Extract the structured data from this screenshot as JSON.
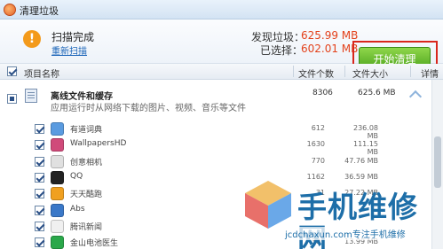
{
  "window": {
    "title": "清理垃圾"
  },
  "summary": {
    "status": "扫描完成",
    "rescan": "重新扫描",
    "found_label": "发现垃圾：",
    "found_value": "625.99 MB",
    "selected_label": "已选择：",
    "selected_value": "602.01 MB",
    "start_button": "开始清理"
  },
  "columns": {
    "name": "项目名称",
    "count": "文件个数",
    "size": "文件大小",
    "detail": "详情"
  },
  "group": {
    "title": "离线文件和缓存",
    "description": "应用运行时从网络下载的图片、视频、音乐等文件",
    "count": "8306",
    "size": "625.6 MB"
  },
  "rows": [
    {
      "name": "有道词典",
      "count": "612",
      "size": "236.08 MB",
      "icon": "book-icon",
      "color": "#5a9be0"
    },
    {
      "name": "WallpapersHD",
      "count": "1630",
      "size": "111.15 MB",
      "icon": "wallpaper-icon",
      "color": "#d04a7a"
    },
    {
      "name": "创意相机",
      "count": "770",
      "size": "47.76 MB",
      "icon": "camera-icon",
      "color": "#e0e0e0"
    },
    {
      "name": "QQ",
      "count": "1162",
      "size": "36.59 MB",
      "icon": "penguin-icon",
      "color": "#222222"
    },
    {
      "name": "天天酷跑",
      "count": "31",
      "size": "27.22 MB",
      "icon": "runner-icon",
      "color": "#f0a020"
    },
    {
      "name": "Abs",
      "count": "",
      "size": "",
      "icon": "fitness-icon",
      "color": "#3a78c8"
    },
    {
      "name": "腾讯新闻",
      "count": "",
      "size": "",
      "icon": "news-icon",
      "color": "#f0f0f0"
    },
    {
      "name": "金山电池医生",
      "count": "307",
      "size": "13.99 MB",
      "icon": "battery-icon",
      "color": "#2aa84a"
    }
  ],
  "watermark": {
    "title": "手机维修网",
    "url": "jcdchaxun.com专注手机维修"
  },
  "colors": {
    "accent_red": "#e3421c",
    "button_green": "#4aa21c",
    "link_blue": "#1a64b8"
  }
}
